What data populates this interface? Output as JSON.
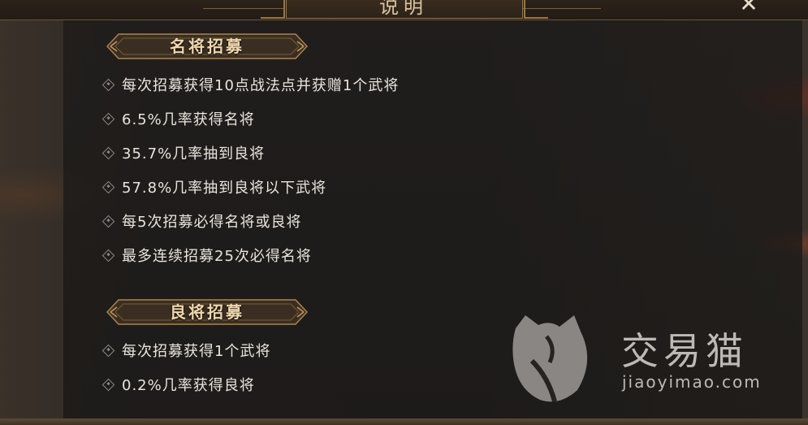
{
  "dialog": {
    "title": "说明",
    "close_glyph": "✕"
  },
  "sections": [
    {
      "header": "名将招募",
      "items": [
        "每次招募获得10点战法点并获赠1个武将",
        "6.5%几率获得名将",
        "35.7%几率抽到良将",
        "57.8%几率抽到良将以下武将",
        "每5次招募必得名将或良将",
        "最多连续招募25次必得名将"
      ]
    },
    {
      "header": "良将招募",
      "items": [
        "每次招募获得1个武将",
        "0.2%几率获得良将"
      ]
    }
  ],
  "watermark": {
    "brand": "交易猫",
    "url": "jiaoyimao.com"
  },
  "colors": {
    "accent_gold": "#9a7544",
    "header_text": "#efd8ae",
    "body_text": "#e9e4dd"
  },
  "icons": [
    "close-icon",
    "diamond-bullet-icon",
    "cat-logo-icon"
  ]
}
